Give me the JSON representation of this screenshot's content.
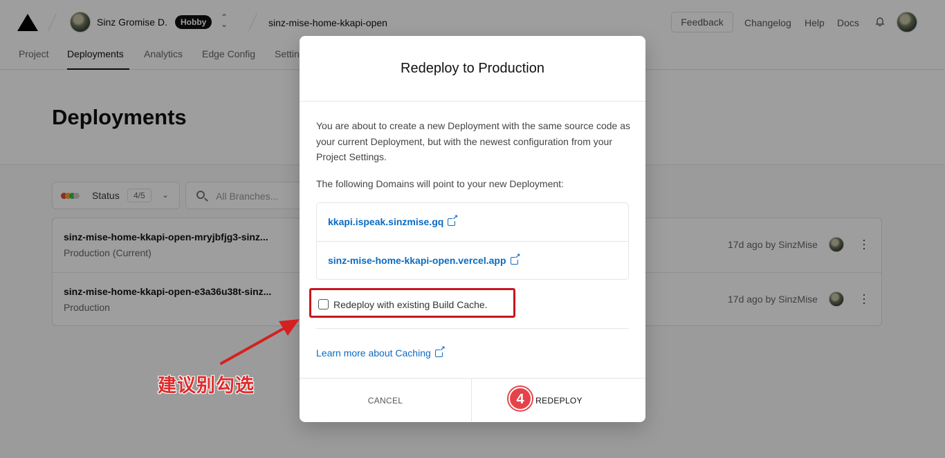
{
  "header": {
    "user_name": "Sinz Gromise D.",
    "plan_badge": "Hobby",
    "project_name": "sinz-mise-home-kkapi-open",
    "feedback_label": "Feedback",
    "links": [
      "Changelog",
      "Help",
      "Docs"
    ]
  },
  "tabs": [
    "Project",
    "Deployments",
    "Analytics",
    "Edge Config",
    "Settin"
  ],
  "active_tab": "Deployments",
  "page": {
    "title": "Deployments",
    "status_filter": {
      "label": "Status",
      "count": "4/5",
      "dot_colors": [
        "#e5434a",
        "#f5a623",
        "#3fb950",
        "#cccccc"
      ]
    },
    "branch_filter_placeholder": "All Branches..."
  },
  "deployments": [
    {
      "name": "sinz-mise-home-kkapi-open-mryjbfjg3-sinz...",
      "environment": "Production (Current)",
      "meta": "17d ago by SinzMise"
    },
    {
      "name": "sinz-mise-home-kkapi-open-e3a36u38t-sinz...",
      "environment": "Production",
      "meta": "17d ago by SinzMise"
    }
  ],
  "modal": {
    "title": "Redeploy to Production",
    "description": "You are about to create a new Deployment with the same source code as your current Deployment, but with the newest configuration from your Project Settings.",
    "domains_intro": "The following Domains will point to your new Deployment:",
    "domains": [
      "kkapi.ispeak.sinzmise.gq",
      "sinz-mise-home-kkapi-open.vercel.app"
    ],
    "cache_checkbox_label": "Redeploy with existing Build Cache.",
    "cache_checked": false,
    "learn_more": "Learn more about Caching",
    "cancel_label": "CANCEL",
    "redeploy_label": "REDEPLOY"
  },
  "annotations": {
    "step_marker": "4",
    "note": "建议别勾选",
    "color": "#e02b2b"
  }
}
